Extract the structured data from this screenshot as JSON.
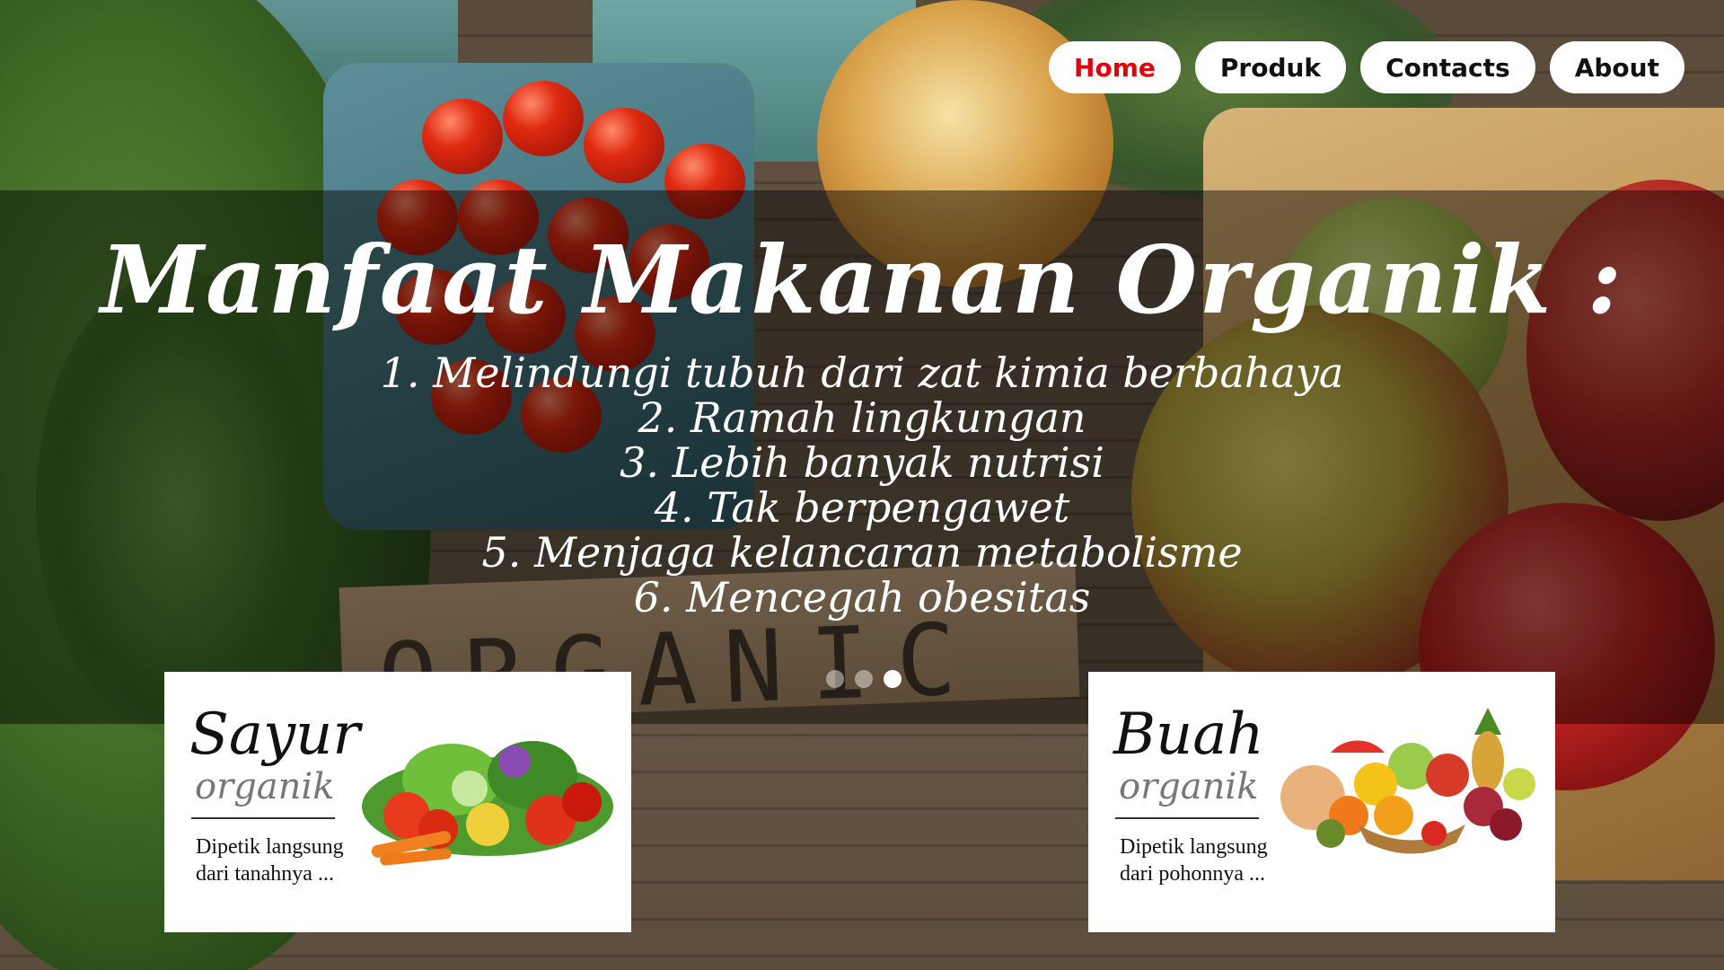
{
  "nav": {
    "items": [
      {
        "label": "Home",
        "active": true
      },
      {
        "label": "Produk",
        "active": false
      },
      {
        "label": "Contacts",
        "active": false
      },
      {
        "label": "About",
        "active": false
      }
    ],
    "active_color": "#e3000b"
  },
  "hero": {
    "title": "Manfaat Makanan Organik :",
    "benefits": [
      "1. Melindungi tubuh dari zat kimia berbahaya",
      "2. Ramah lingkungan",
      "3. Lebih banyak nutrisi",
      "4. Tak berpengawet",
      "5. Menjaga kelancaran metabolisme",
      "6. Mencegah obesitas"
    ],
    "slider": {
      "count": 3,
      "active_index": 2
    },
    "background_sign_text": "ORGANIC"
  },
  "cards": [
    {
      "title": "Sayur",
      "subtitle": "organik",
      "description": "Dipetik langsung dari tanahnya ...",
      "image": "vegetables-image"
    },
    {
      "title": "Buah",
      "subtitle": "organik",
      "description": "Dipetik langsung dari pohonnya ...",
      "image": "fruits-image"
    }
  ]
}
